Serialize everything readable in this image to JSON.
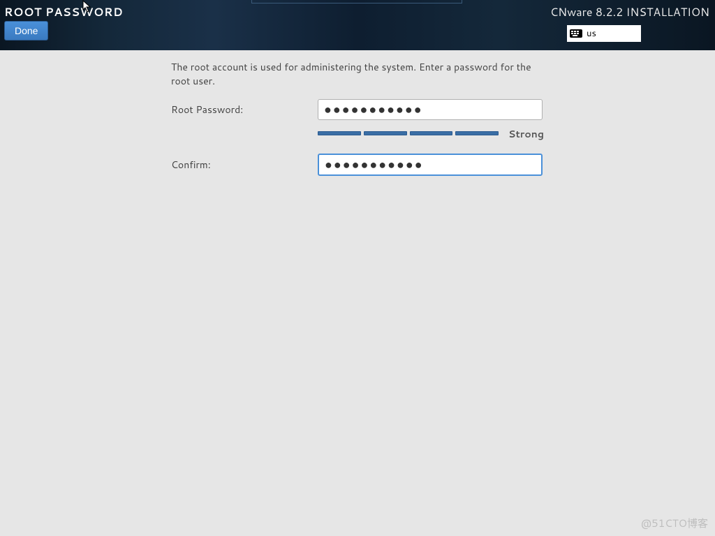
{
  "header": {
    "page_title": "ROOT PASSWORD",
    "done_label": "Done",
    "installation_title": "CNware 8.2.2 INSTALLATION",
    "keyboard_layout": "us"
  },
  "main": {
    "description": "The root account is used for administering the system.  Enter a password for the root user.",
    "root_password_label": "Root Password:",
    "root_password_value": "●●●●●●●●●●●",
    "confirm_label": "Confirm:",
    "confirm_value": "●●●●●●●●●●●",
    "strength_label": "Strong",
    "strength_segments_filled": 4,
    "strength_segments_total": 4
  },
  "watermark": "@51CTO博客"
}
